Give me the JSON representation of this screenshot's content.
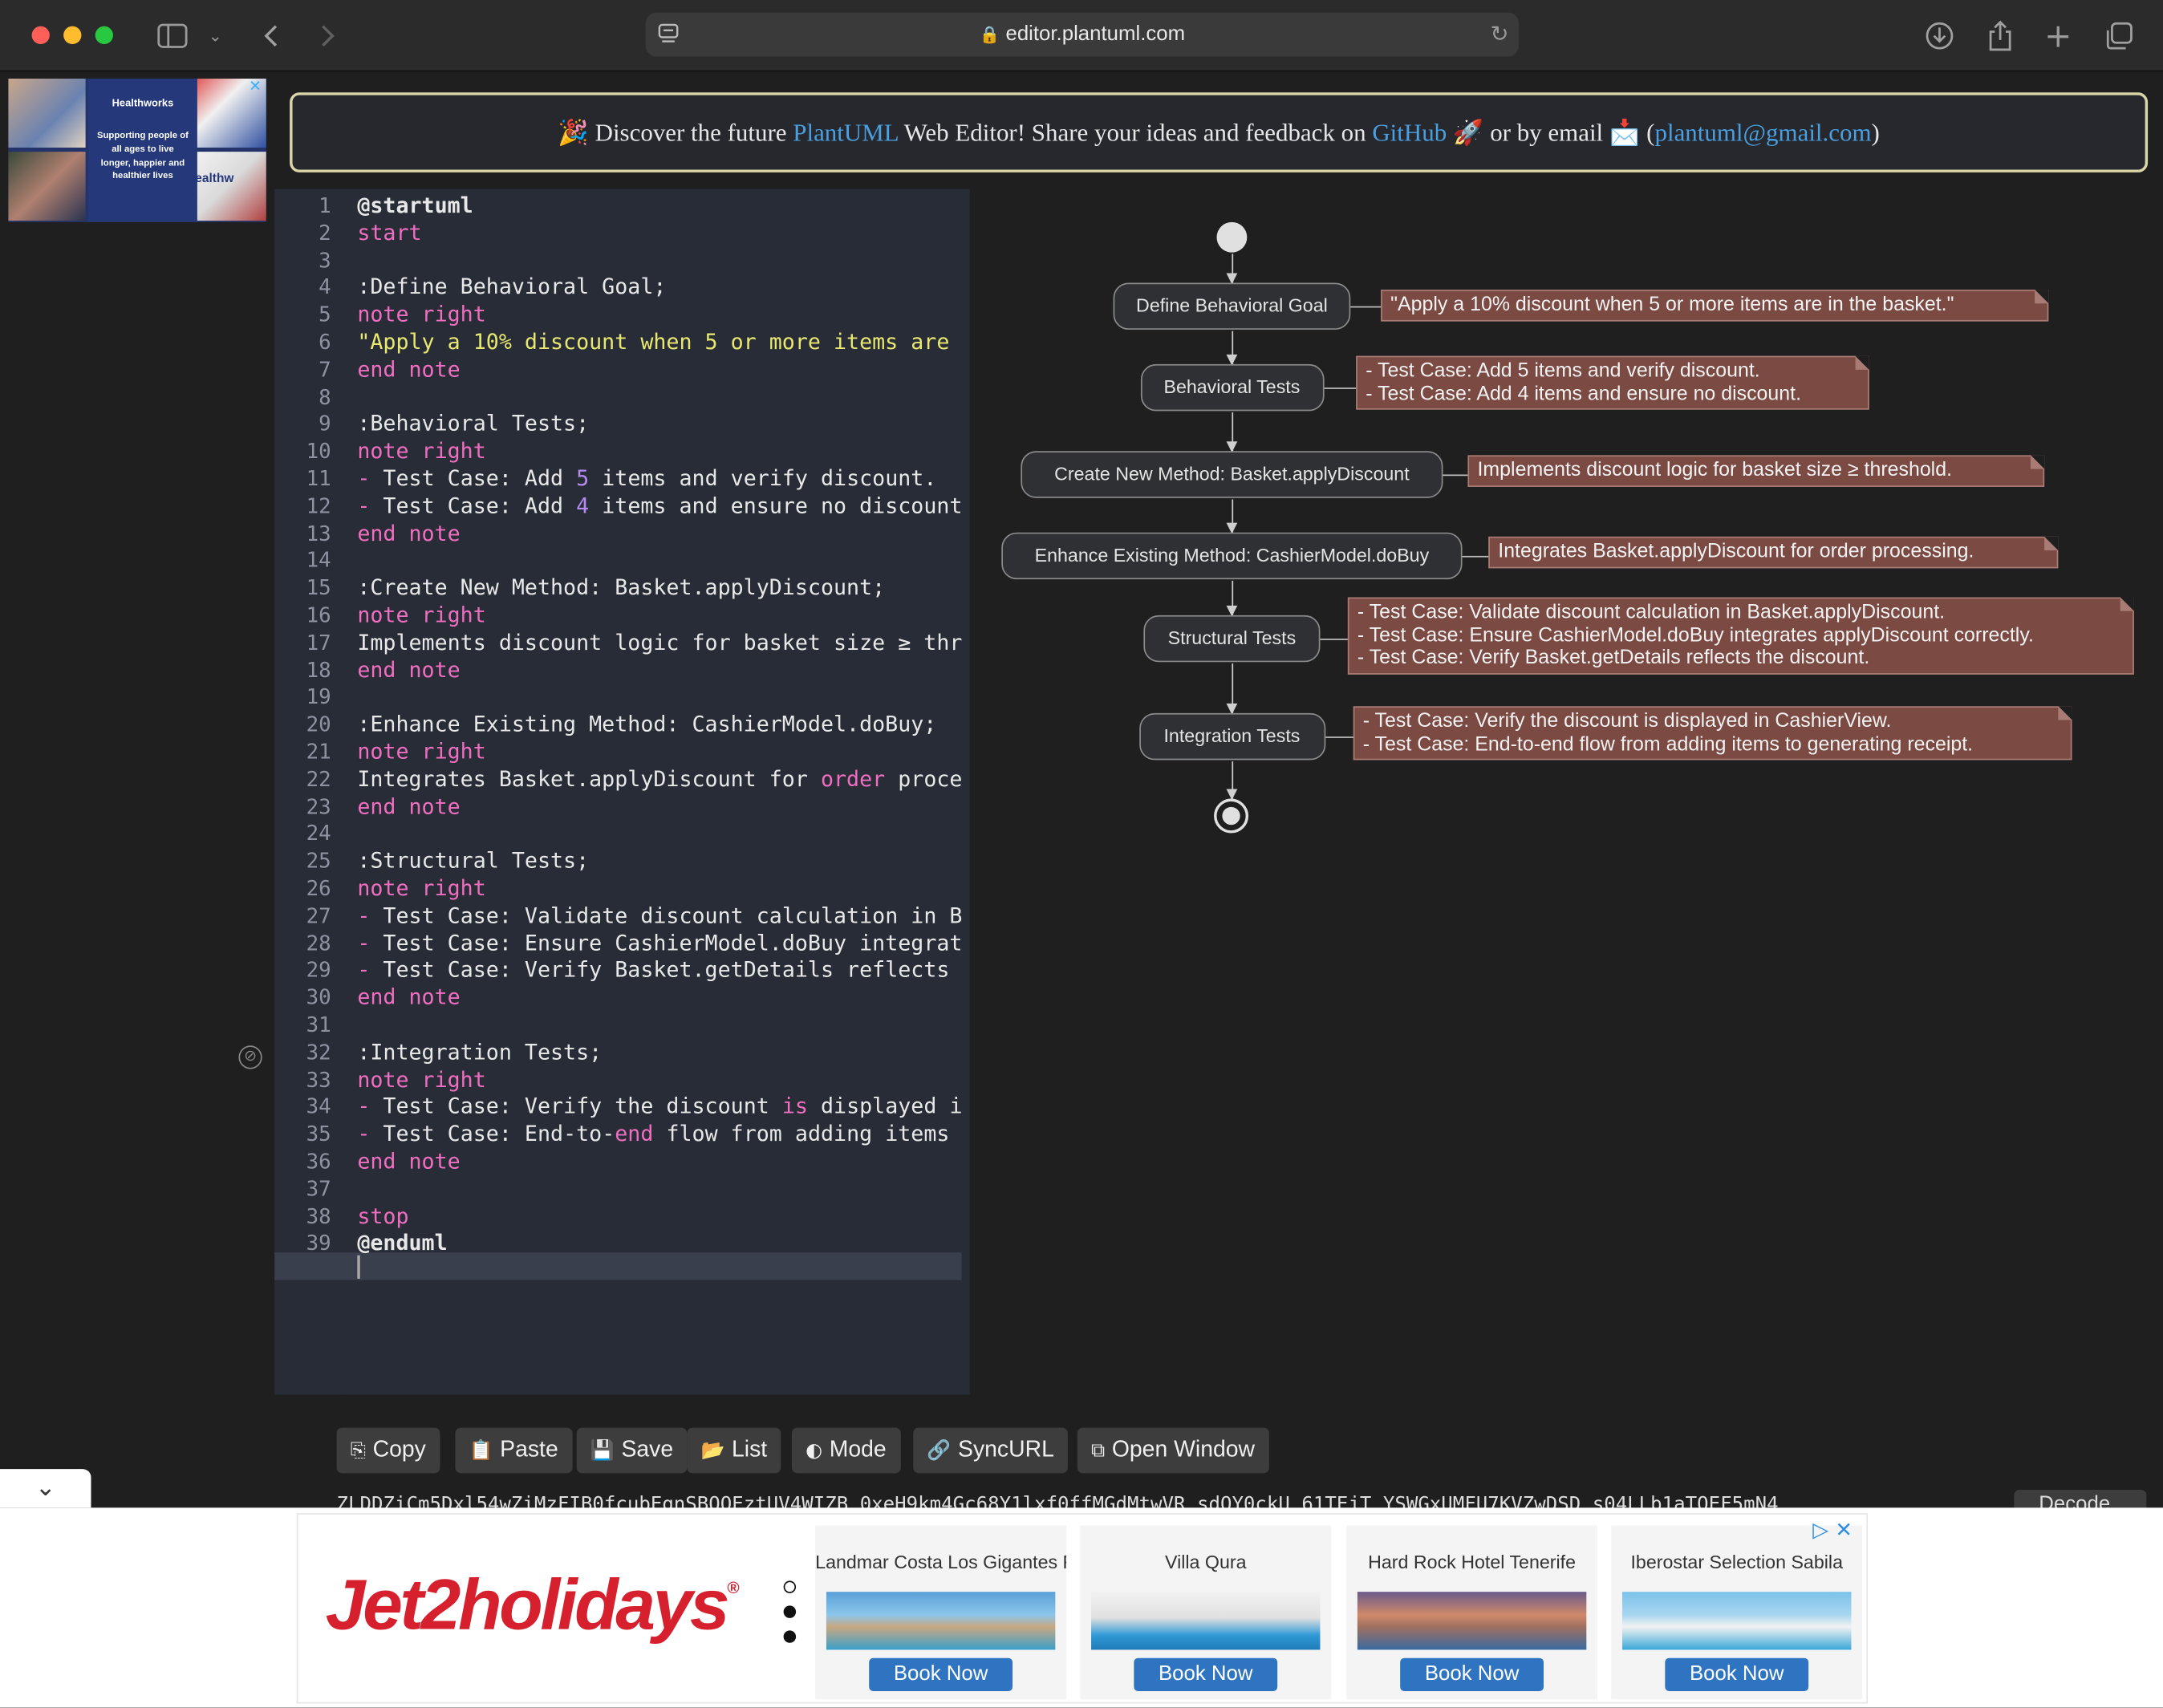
{
  "browser": {
    "url": "editor.plantuml.com",
    "icons": [
      "sidebar-icon",
      "chevron-down-icon",
      "back-icon",
      "forward-icon",
      "reader-icon",
      "lock-icon",
      "reload-icon",
      "download-icon",
      "share-icon",
      "new-tab-icon",
      "tabs-overview-icon"
    ]
  },
  "left_ad": {
    "brand": "Healthworks",
    "tagline": "Supporting people of all ages to live longer, happier and healthier lives",
    "corner_text": "Healthw"
  },
  "banner": {
    "emoji_party": "🎉",
    "text_1": "Discover the future ",
    "link_1": "PlantUML",
    "text_2": " Web Editor! Share your ideas and feedback on ",
    "link_2": "GitHub",
    "emoji_rocket": "🚀",
    "text_3": " or by email ",
    "emoji_mail": "📩",
    "text_4": " (",
    "link_3": "plantuml@gmail.com",
    "text_5": ")"
  },
  "editor": {
    "lines": [
      "@startuml",
      "start",
      "",
      ":Define Behavioral Goal;",
      "note right",
      "\"Apply a 10% discount when 5 or more items are",
      "end note",
      "",
      ":Behavioral Tests;",
      "note right",
      "- Test Case: Add 5 items and verify discount.",
      "- Test Case: Add 4 items and ensure no discount",
      "end note",
      "",
      ":Create New Method: Basket.applyDiscount;",
      "note right",
      "Implements discount logic for basket size ≥ thr",
      "end note",
      "",
      ":Enhance Existing Method: CashierModel.doBuy;",
      "note right",
      "Integrates Basket.applyDiscount for order proce",
      "end note",
      "",
      ":Structural Tests;",
      "note right",
      "- Test Case: Validate discount calculation in B",
      "- Test Case: Ensure CashierModel.doBuy integrat",
      "- Test Case: Verify Basket.getDetails reflects ",
      "end note",
      "",
      ":Integration Tests;",
      "note right",
      "- Test Case: Verify the discount is displayed i",
      "- Test Case: End-to-end flow from adding items ",
      "end note",
      "",
      "stop",
      "@enduml",
      ""
    ]
  },
  "diagram": {
    "activities": [
      {
        "label": "Define Behavioral Goal",
        "note": "\"Apply a 10% discount when 5 or more items are in the basket.\""
      },
      {
        "label": "Behavioral Tests",
        "note": "- Test Case: Add 5 items and verify discount.\n- Test Case: Add 4 items and ensure no discount."
      },
      {
        "label": "Create New Method: Basket.applyDiscount",
        "note": "Implements discount logic for basket size ≥ threshold."
      },
      {
        "label": "Enhance Existing Method: CashierModel.doBuy",
        "note": "Integrates Basket.applyDiscount for order processing."
      },
      {
        "label": "Structural Tests",
        "note": "- Test Case: Validate discount calculation in Basket.applyDiscount.\n- Test Case: Ensure CashierModel.doBuy integrates applyDiscount correctly.\n- Test Case: Verify Basket.getDetails reflects the discount."
      },
      {
        "label": "Integration Tests",
        "note": "- Test Case: Verify the discount is displayed in CashierView.\n- Test Case: End-to-end flow from adding items to generating receipt."
      }
    ]
  },
  "toolbar": {
    "copy": "Copy",
    "paste": "Paste",
    "save": "Save",
    "list": "List",
    "mode": "Mode",
    "syncurl": "SyncURL",
    "open_window": "Open Window",
    "encoded": "ZLDDZiCm5Dxl54wZiMzFIB0fcubEgnSBQOEztUV4WIZB_0xeH9km4Gc68Y1lxf0ffMGdMtwVR_sdOY0ckU_61TEjT_YSWGxUMFU7KVZwDSD_s04LLb1aTQEF5mN4",
    "decode": "Decode"
  },
  "bottom_ad": {
    "brand": "Jet2holidays",
    "brand_mark": "®",
    "hotels": [
      {
        "name": "Landmar Costa Los Gigantes Fa...",
        "cta": "Book Now"
      },
      {
        "name": "Villa Qura",
        "cta": "Book Now"
      },
      {
        "name": "Hard Rock Hotel Tenerife",
        "cta": "Book Now"
      },
      {
        "name": "Iberostar Selection Sabila",
        "cta": "Book Now"
      }
    ]
  },
  "colors": {
    "banner_link": "#4a9fe0",
    "keyword": "#f06ec0",
    "string": "#e8e870",
    "number": "#b48bf0",
    "note_bg": "#7b4a43",
    "jet2_red": "#d6202e",
    "book_button": "#2f74c0"
  }
}
